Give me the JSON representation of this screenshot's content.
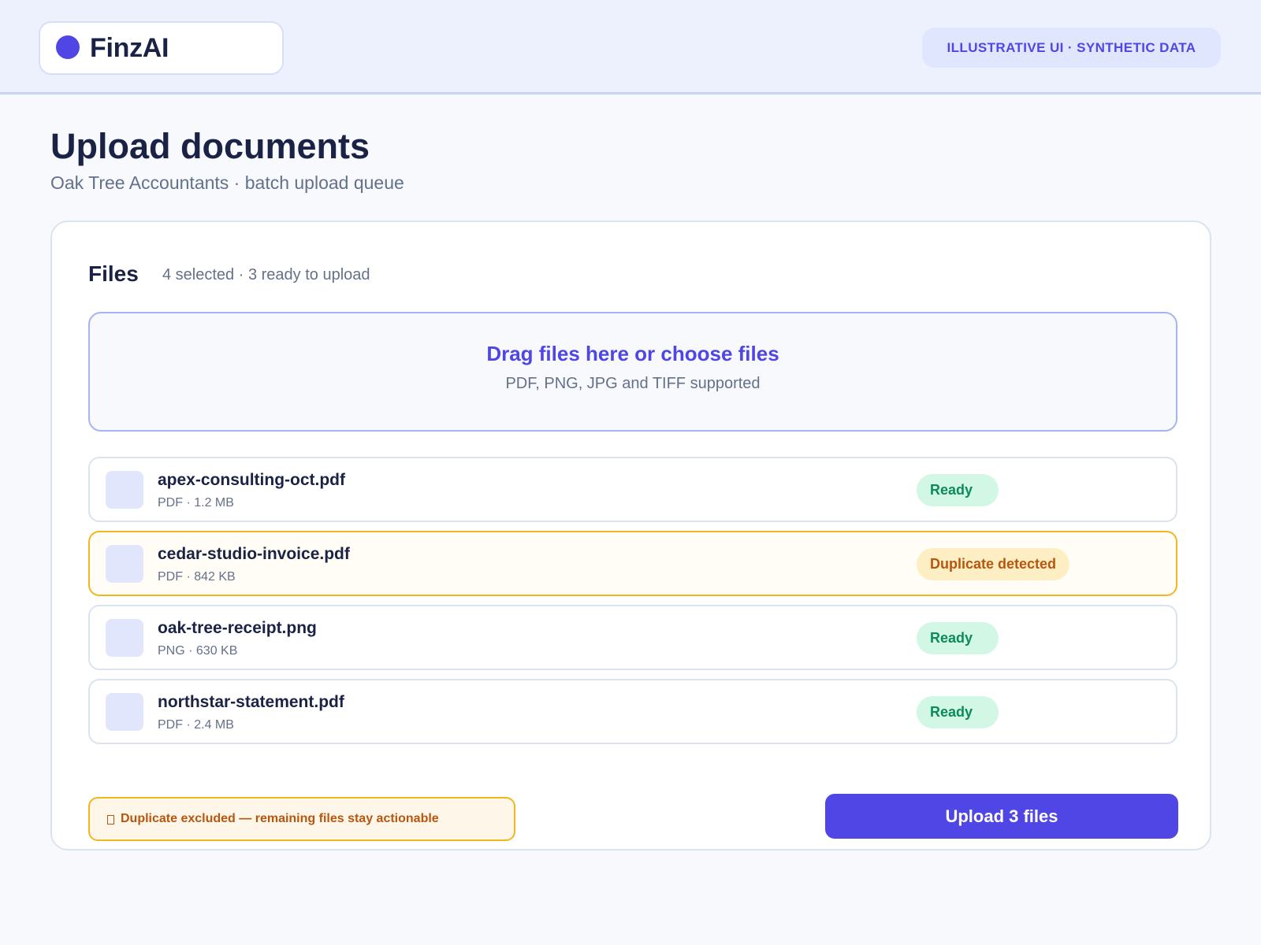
{
  "header": {
    "brand_name": "FinzAI",
    "badge": "ILLUSTRATIVE UI · SYNTHETIC DATA"
  },
  "page": {
    "title": "Upload documents",
    "subtitle": "Oak Tree Accountants · batch upload queue"
  },
  "files_panel": {
    "title": "Files",
    "meta": "4 selected · 3 ready to upload",
    "dropzone": {
      "main": "Drag files here or choose files",
      "sub": "PDF, PNG, JPG and TIFF supported"
    },
    "files": [
      {
        "name": "apex-consulting-oct.pdf",
        "meta": "PDF · 1.2 MB",
        "status": "Ready"
      },
      {
        "name": "cedar-studio-invoice.pdf",
        "meta": "PDF · 842 KB",
        "status": "Duplicate detected"
      },
      {
        "name": "oak-tree-receipt.png",
        "meta": "PNG · 630 KB",
        "status": "Ready"
      },
      {
        "name": "northstar-statement.pdf",
        "meta": "PDF · 2.4 MB",
        "status": "Ready"
      }
    ],
    "duplicate_note": "Duplicate excluded — remaining files stay actionable",
    "upload_button": "Upload 3 files"
  },
  "colors": {
    "accent": "#4f46e5",
    "ready": "#0d8a5a",
    "duplicate": "#b7560e",
    "duplicate_border": "#f2b623"
  },
  "icons": {
    "brand": "brand-dot-icon",
    "duplicate_note": "warning-icon"
  }
}
